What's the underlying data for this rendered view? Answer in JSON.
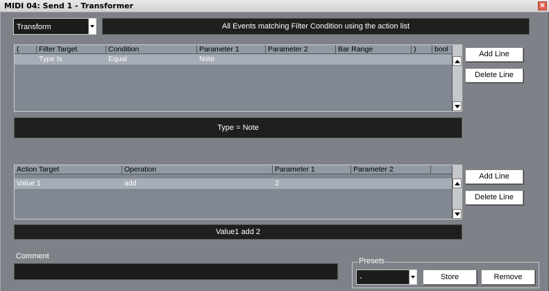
{
  "window": {
    "title": "MIDI 04: Send 1 - Transformer",
    "close_glyph": "✕"
  },
  "function": {
    "mode_value": "Transform",
    "description": "All Events matching Filter Condition using the action list"
  },
  "filter_table": {
    "headers": [
      "(",
      "Filter Target",
      "Condition",
      "Parameter 1",
      "Parameter 2",
      "Bar Range",
      ")",
      "bool"
    ],
    "rows": [
      {
        "open": "",
        "target": "Type Is",
        "condition": "Equal",
        "param1": "Note",
        "param2": "",
        "bar_range": "",
        "close": "",
        "bool": ""
      }
    ],
    "summary": "Type = Note",
    "add_label": "Add Line",
    "delete_label": "Delete Line"
  },
  "action_table": {
    "headers": [
      "Action Target",
      "Operation",
      "Parameter 1",
      "Parameter 2"
    ],
    "rows": [
      {
        "target": "Value 1",
        "operation": "add",
        "param1": "2",
        "param2": ""
      }
    ],
    "summary": "Value1 add 2",
    "add_label": "Add Line",
    "delete_label": "Delete Line"
  },
  "comment": {
    "label": "Comment",
    "value": ""
  },
  "presets": {
    "label": "Presets",
    "selected": "-",
    "store_label": "Store",
    "remove_label": "Remove"
  }
}
